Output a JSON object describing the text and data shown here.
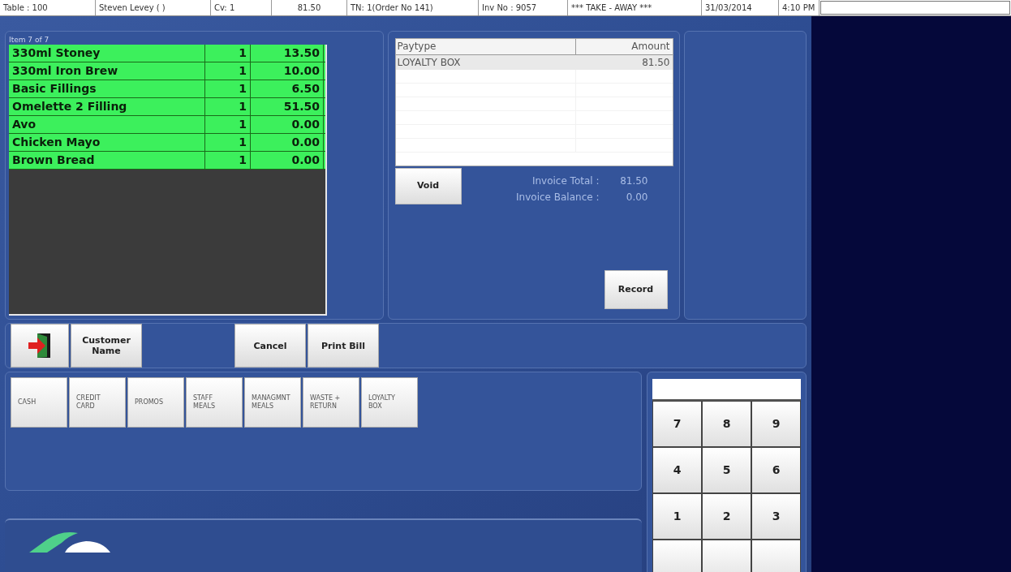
{
  "header_fields": [
    "Table : 100",
    "Steven Levey (  )",
    "Cv: 1",
    "81.50",
    "TN: 1(Order No 141)",
    "Inv No : 9057",
    "*** TAKE - AWAY ***",
    "31/03/2014",
    "4:10 PM"
  ],
  "order": {
    "item_counter": "Item 7 of 7",
    "items": [
      {
        "name": "330ml Stoney",
        "qty": "1",
        "price": "13.50",
        "selected": true
      },
      {
        "name": "330ml Iron Brew",
        "qty": "1",
        "price": "10.00",
        "selected": true
      },
      {
        "name": "Basic Fillings",
        "qty": "1",
        "price": "6.50",
        "selected": true
      },
      {
        "name": "Omelette 2 Filling",
        "qty": "1",
        "price": "51.50",
        "selected": true
      },
      {
        "name": "Avo",
        "qty": "1",
        "price": "0.00",
        "selected": true
      },
      {
        "name": "Chicken Mayo",
        "qty": "1",
        "price": "0.00",
        "selected": true
      },
      {
        "name": "Brown Bread",
        "qty": "1",
        "price": "0.00",
        "selected": true
      }
    ]
  },
  "payments": {
    "columns": [
      "Paytype",
      "Amount"
    ],
    "rows": [
      {
        "paytype": "LOYALTY BOX",
        "amount": "81.50"
      }
    ],
    "void_button": "Void",
    "totals": [
      {
        "label": "Invoice Total :",
        "value": "81.50"
      },
      {
        "label": "Invoice Balance :",
        "value": "0.00"
      }
    ],
    "record_button": "Record"
  },
  "action_buttons": [
    {
      "kind": "icon"
    },
    {
      "kind": "text",
      "label": "Customer Name"
    },
    {
      "kind": "gap"
    },
    {
      "kind": "text",
      "label": "Cancel"
    },
    {
      "kind": "text",
      "label": "Print Bill"
    }
  ],
  "paytype_buttons": [
    {
      "label": "CASH"
    },
    {
      "label": "CREDIT CARD"
    },
    {
      "label": "PROMOS"
    },
    {
      "label": "STAFF MEALS"
    },
    {
      "label": "MANAGMNT MEALS"
    },
    {
      "label": "WASTE + RETURN"
    },
    {
      "label": "LOYALTY BOX"
    }
  ],
  "keypad": {
    "keys": [
      "7",
      "8",
      "9",
      "4",
      "5",
      "6",
      "1",
      "2",
      "3"
    ]
  }
}
